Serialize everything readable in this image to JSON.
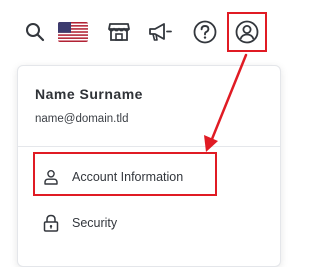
{
  "topbar": {
    "icons": [
      "search-icon",
      "us-flag-icon",
      "store-icon",
      "megaphone-icon",
      "help-icon",
      "user-profile-icon"
    ]
  },
  "user": {
    "name": "Name Surname",
    "email": "name@domain.tld"
  },
  "menu": {
    "items": [
      {
        "label": "Account Information",
        "icon": "user-icon"
      },
      {
        "label": "Security",
        "icon": "lock-icon"
      }
    ]
  },
  "colors": {
    "icon": "#33373d",
    "highlight": "#e01b24",
    "border": "#e4e6ea"
  }
}
